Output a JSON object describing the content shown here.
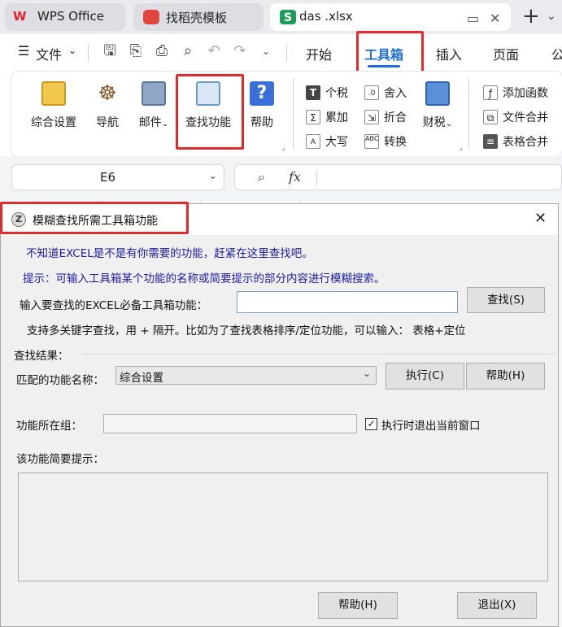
{
  "tabs": [
    {
      "label": "WPS Office",
      "icon": "wps-logo-icon"
    },
    {
      "label": "找稻壳模板",
      "icon": "daoke-logo-icon"
    },
    {
      "label": "das .xlsx",
      "icon": "spreadsheet-s-icon"
    }
  ],
  "menu": {
    "file_label": "文件",
    "tabs": [
      "开始",
      "工具箱",
      "插入",
      "页面",
      "公"
    ],
    "active_tab": "工具箱"
  },
  "ribbon": {
    "big_buttons": [
      {
        "label": "综合设置",
        "icon": "settings-panel-icon"
      },
      {
        "label": "导航",
        "icon": "helm-wheel-icon"
      },
      {
        "label": "邮件",
        "icon": "mail-icon"
      },
      {
        "label": "查找功能",
        "icon": "find-feature-icon"
      },
      {
        "label": "帮助",
        "icon": "help-question-icon"
      }
    ],
    "small_col1": [
      "个税",
      "累加",
      "大写"
    ],
    "small_col2": [
      "舍入",
      "折合",
      "转换"
    ],
    "caishui_label": "财税",
    "small_col3": [
      "添加函数",
      "文件合并",
      "表格合并"
    ]
  },
  "formula_bar": {
    "cell_ref": "E6",
    "fx_symbol": "fx"
  },
  "dialog": {
    "title": "模糊查找所需工具箱功能",
    "hint_line1": "不知道EXCEL是不是有你需要的功能，赶紧在这里查找吧。",
    "hint_line2": "提示：可输入工具箱某个功能的名称或简要提示的部分内容进行模糊搜索。",
    "search_label": "输入要查找的EXCEL必备工具箱功能：",
    "search_value": "",
    "search_button": "查找(S)",
    "multi_keyword_hint": "支持多关键字查找，用 + 隔开。比如为了查找表格排序/定位功能，可以输入： 表格+定位",
    "results_label": "查找结果：",
    "match_label": "匹配的功能名称：",
    "match_value": "综合设置",
    "execute_button": "执行(C)",
    "help_button_top": "帮助(H)",
    "group_label": "功能所在组：",
    "group_value": "",
    "exit_on_run_label": "执行时退出当前窗口",
    "exit_on_run_checked": true,
    "brief_label": "该功能简要提示：",
    "brief_value": "",
    "help_button_bottom": "帮助(H)",
    "exit_button": "退出(X)"
  },
  "colors": {
    "highlight_red": "#e32a2a",
    "hint_blue": "#1a1aa6",
    "wps_red": "#e8202a",
    "sheet_green": "#1d9a5c"
  }
}
